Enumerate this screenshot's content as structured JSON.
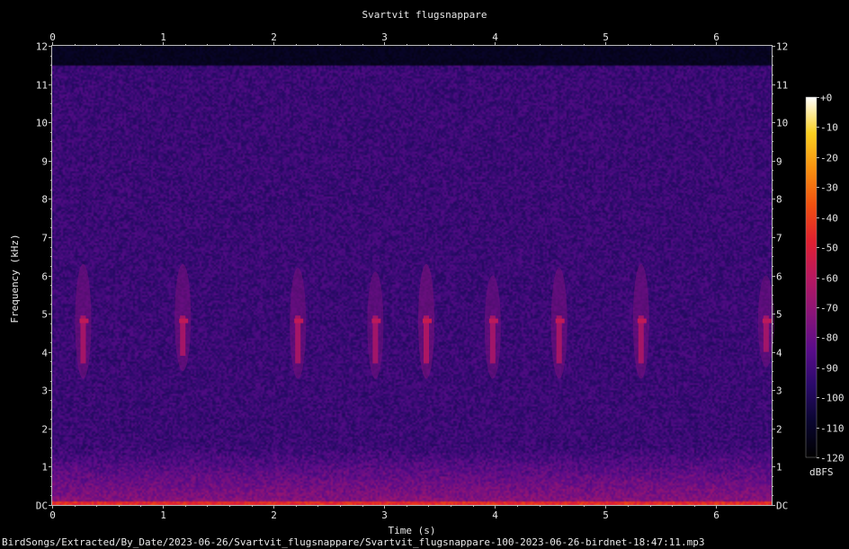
{
  "chart_data": {
    "type": "heatmap",
    "title": "Svartvit flugsnappare",
    "xlabel": "Time (s)",
    "ylabel": "Frequency (kHz)",
    "xlim": [
      0,
      6.5
    ],
    "ylim": [
      0,
      12
    ],
    "x_ticks": [
      0,
      1,
      2,
      3,
      4,
      5,
      6
    ],
    "x_tick_labels": [
      "0",
      "1",
      "2",
      "3",
      "4",
      "5",
      "6"
    ],
    "y_ticks": [
      0,
      1,
      2,
      3,
      4,
      5,
      6,
      7,
      8,
      9,
      10,
      11,
      12
    ],
    "y_tick_labels": [
      "DC",
      "1",
      "2",
      "3",
      "4",
      "5",
      "6",
      "7",
      "8",
      "9",
      "10",
      "11",
      "12"
    ],
    "colorbar": {
      "unit": "dBFS",
      "range": [
        -120,
        0
      ],
      "ticks": [
        0,
        -10,
        -20,
        -30,
        -40,
        -50,
        -60,
        -70,
        -80,
        -90,
        -100,
        -110,
        -120
      ],
      "tick_labels": [
        "+0",
        "-10",
        "-20",
        "-30",
        "-40",
        "-50",
        "-60",
        "-70",
        "-80",
        "-90",
        "-100",
        "-110",
        "-120"
      ],
      "colormap": [
        "#000000",
        "#0a0630",
        "#2a0a6a",
        "#5a0c8a",
        "#8a1478",
        "#b81860",
        "#e02030",
        "#f05010",
        "#f89010",
        "#fad020",
        "#ffffff"
      ]
    },
    "noise_level_dbfs": -92,
    "noise_cutoff_khz": 11.5,
    "low_band": {
      "top_khz": 1.5,
      "level_dbfs": -72,
      "dc_level_dbfs": -45
    },
    "calls": [
      {
        "t": 0.28,
        "f_low": 3.3,
        "f_high": 6.3,
        "peak_khz": 4.8,
        "peak_dbfs": -62
      },
      {
        "t": 1.18,
        "f_low": 3.5,
        "f_high": 6.3,
        "peak_khz": 4.8,
        "peak_dbfs": -62
      },
      {
        "t": 2.22,
        "f_low": 3.3,
        "f_high": 6.2,
        "peak_khz": 4.8,
        "peak_dbfs": -62
      },
      {
        "t": 2.92,
        "f_low": 3.3,
        "f_high": 6.1,
        "peak_khz": 4.8,
        "peak_dbfs": -63
      },
      {
        "t": 3.38,
        "f_low": 3.3,
        "f_high": 6.3,
        "peak_khz": 4.8,
        "peak_dbfs": -60
      },
      {
        "t": 3.98,
        "f_low": 3.3,
        "f_high": 6.0,
        "peak_khz": 4.8,
        "peak_dbfs": -63
      },
      {
        "t": 4.58,
        "f_low": 3.3,
        "f_high": 6.2,
        "peak_khz": 4.8,
        "peak_dbfs": -62
      },
      {
        "t": 5.32,
        "f_low": 3.3,
        "f_high": 6.3,
        "peak_khz": 4.8,
        "peak_dbfs": -62
      },
      {
        "t": 6.45,
        "f_low": 3.6,
        "f_high": 6.0,
        "peak_khz": 4.8,
        "peak_dbfs": -63
      }
    ]
  },
  "footer": {
    "file_path": "BirdSongs/Extracted/By_Date/2023-06-26/Svartvit_flugsnappare/Svartvit_flugsnappare-100-2023-06-26-birdnet-18:47:11.mp3"
  }
}
